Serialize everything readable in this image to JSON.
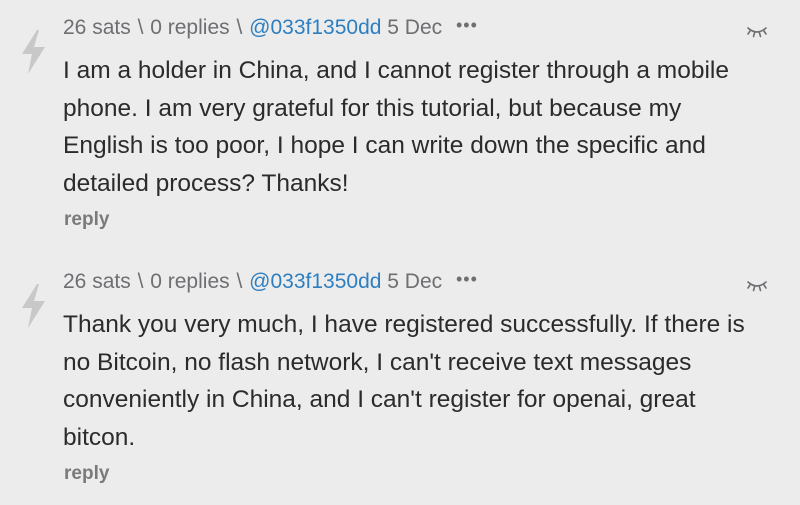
{
  "comments": [
    {
      "sats": "26 sats",
      "sep1": "\\",
      "replies": "0 replies",
      "sep2": "\\",
      "user": "@033f1350dd",
      "date": "5 Dec",
      "dots": "•••",
      "text": "I am a holder in China, and I cannot register through a mobile phone. I am very grateful for this tutorial, but because my English is too poor, I hope I can write down the specific and detailed process? Thanks!",
      "reply_label": "reply"
    },
    {
      "sats": "26 sats",
      "sep1": "\\",
      "replies": "0 replies",
      "sep2": "\\",
      "user": "@033f1350dd",
      "date": "5 Dec",
      "dots": "•••",
      "text": "Thank you very much, I have registered successfully. If there is no Bitcoin, no flash network, I can't receive text messages conveniently in China, and I can't register for openai, great bitcon.",
      "reply_label": "reply"
    }
  ],
  "icons": {
    "zap": "lightning-bolt-icon",
    "collapse": "collapse-eye-icon"
  },
  "colors": {
    "background": "#ececec",
    "link": "#2d7fc1",
    "meta": "#6e6e73",
    "text": "#2b2b2b",
    "bolt": "#c8c8c8"
  }
}
